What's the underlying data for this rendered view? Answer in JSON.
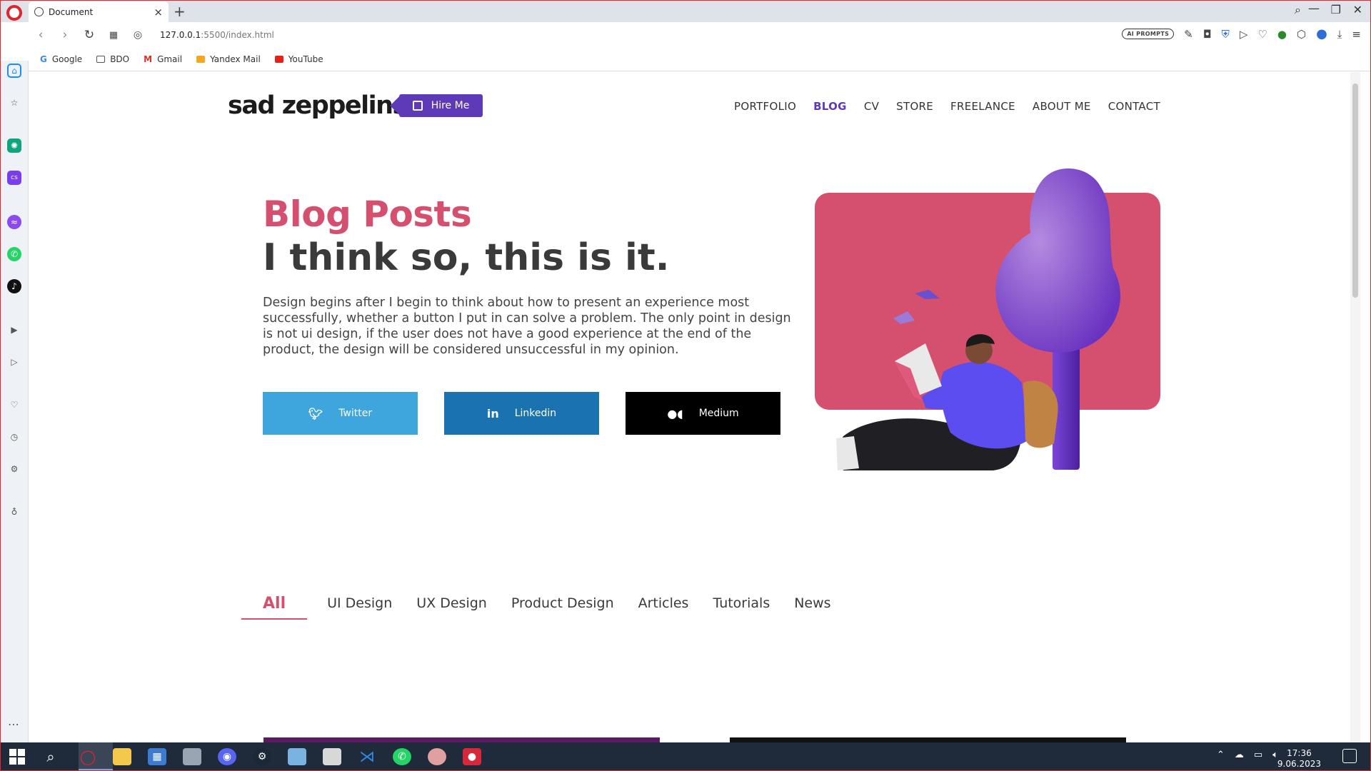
{
  "browser": {
    "tab_title": "Document",
    "url_host": "127.0.0.1",
    "url_path": ":5500/index.html",
    "ai_prompts": "AI PROMPTS",
    "bookmarks": [
      "Google",
      "BDO",
      "Gmail",
      "Yandex Mail",
      "YouTube"
    ]
  },
  "site": {
    "logo": "sad zeppelins",
    "hire_label": "Hire Me",
    "nav": [
      "PORTFOLIO",
      "BLOG",
      "CV",
      "STORE",
      "FREELANCE",
      "ABOUT ME",
      "CONTACT"
    ],
    "active_nav": "BLOG"
  },
  "hero": {
    "title": "Blog Posts",
    "subtitle": "I think so, this is it.",
    "body": "Design begins after I begin to think about how to present an experience most successfully, whether a button I put in can solve a problem. The only point in design is not ui design, if the user does not have a good experience at the end of the product, the design will be considered unsuccessful in my opinion.",
    "buttons": [
      {
        "label": "Twitter",
        "color": "#3fa5dd"
      },
      {
        "label": "Linkedin",
        "color": "#1a72b0"
      },
      {
        "label": "Medium",
        "color": "#000000"
      }
    ]
  },
  "filters": {
    "items": [
      "All",
      "UI Design",
      "UX Design",
      "Product Design",
      "Articles",
      "Tutorials",
      "News"
    ],
    "active": "All"
  },
  "colors": {
    "accent": "#d4506e",
    "brand_purple": "#5f3ab8"
  },
  "taskbar": {
    "time": "17:36",
    "date": "9.06.2023"
  }
}
